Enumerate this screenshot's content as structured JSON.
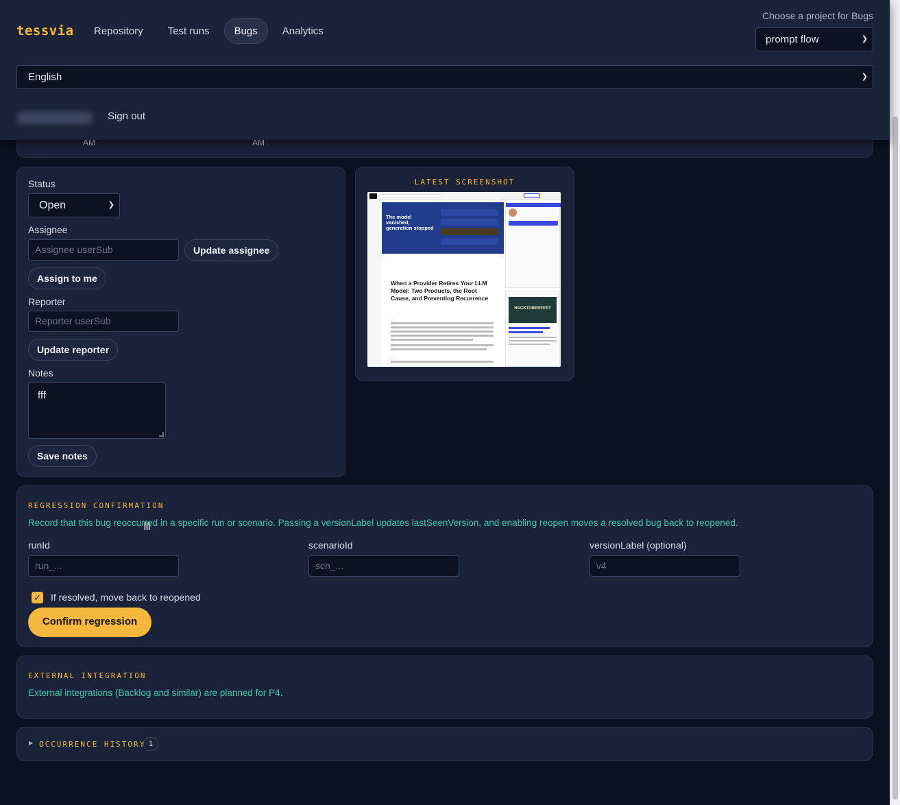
{
  "header": {
    "brand": "tessvia",
    "nav": [
      {
        "label": "Repository"
      },
      {
        "label": "Test runs"
      },
      {
        "label": "Bugs",
        "active": true
      },
      {
        "label": "Analytics"
      }
    ],
    "project_label": "Choose a project for Bugs",
    "project_value": "prompt flow",
    "language_value": "English",
    "signout_label": "Sign out"
  },
  "peek": {
    "left_am": "AM",
    "right_am": "AM"
  },
  "edit": {
    "status_label": "Status",
    "status_value": "Open",
    "assignee_label": "Assignee",
    "assignee_placeholder": "Assignee userSub",
    "update_assignee": "Update assignee",
    "assign_to_me": "Assign to me",
    "reporter_label": "Reporter",
    "reporter_placeholder": "Reporter userSub",
    "update_reporter": "Update reporter",
    "notes_label": "Notes",
    "notes_value": "fff",
    "save_notes": "Save notes"
  },
  "screenshot": {
    "title": "LATEST SCREENSHOT",
    "headline": "When a Provider Retires Your LLM Model: Two Products, the Root Cause, and Preventing Recurrence",
    "hero_text": "The model vanished, generation stopped",
    "side_label": "HACKTOBERFEST"
  },
  "regression": {
    "title": "REGRESSION CONFIRMATION",
    "description": "Record that this bug reoccurred in a specific run or scenario. Passing a versionLabel updates lastSeenVersion, and enabling reopen moves a resolved bug back to reopened.",
    "fields": [
      {
        "label": "runId",
        "placeholder": "run_..."
      },
      {
        "label": "scenarioId",
        "placeholder": "scn_..."
      },
      {
        "label": "versionLabel (optional)",
        "placeholder": "v4"
      }
    ],
    "reopen_label": "If resolved, move back to reopened",
    "reopen_checked": true,
    "confirm_label": "Confirm regression"
  },
  "external": {
    "title": "EXTERNAL INTEGRATION",
    "description": "External integrations (Backlog and similar) are planned for P4."
  },
  "occurrence": {
    "title": "OCCURRENCE HISTORY",
    "count": "1"
  }
}
